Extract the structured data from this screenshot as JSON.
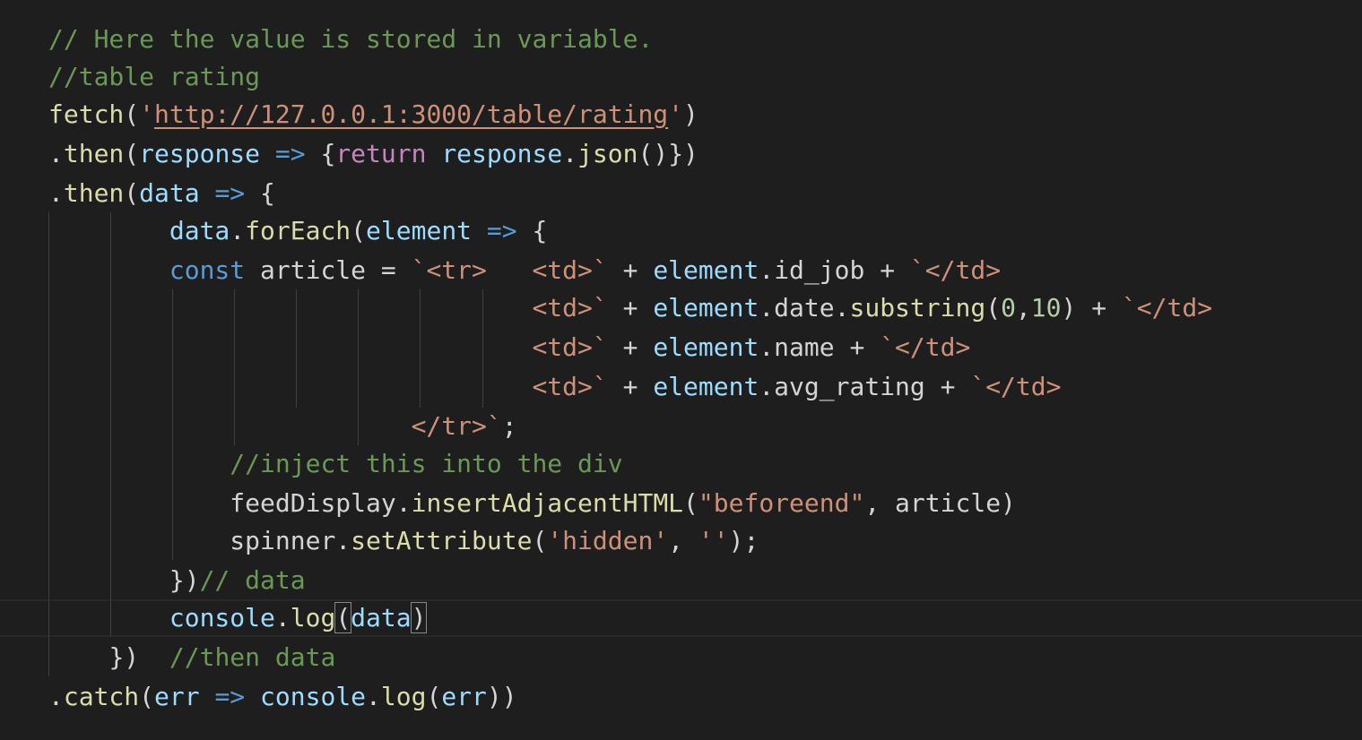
{
  "editor": {
    "theme_colors": {
      "background": "#1e1e1e",
      "comment": "#6a9955",
      "function": "#dcdcaa",
      "string": "#ce9178",
      "variable": "#9cdcfe",
      "keyword": "#569cd6",
      "control": "#c586c0",
      "number": "#b5cea8",
      "plain": "#d4d4d4"
    },
    "lines": [
      {
        "indent": 0,
        "tokens": [
          {
            "t": "com",
            "v": "// Here the value is stored in variable."
          }
        ]
      },
      {
        "indent": 0,
        "tokens": [
          {
            "t": "com",
            "v": "//table rating"
          }
        ]
      },
      {
        "indent": 0,
        "tokens": [
          {
            "t": "fn",
            "v": "fetch"
          },
          {
            "t": "pl",
            "v": "("
          },
          {
            "t": "str",
            "v": "'"
          },
          {
            "t": "url",
            "v": "http://127.0.0.1:3000/table/rating"
          },
          {
            "t": "str",
            "v": "'"
          },
          {
            "t": "pl",
            "v": ")"
          }
        ]
      },
      {
        "indent": 0,
        "tokens": [
          {
            "t": "pl",
            "v": "."
          },
          {
            "t": "fn",
            "v": "then"
          },
          {
            "t": "pl",
            "v": "("
          },
          {
            "t": "var",
            "v": "response"
          },
          {
            "t": "pl",
            "v": " "
          },
          {
            "t": "kw",
            "v": "=>"
          },
          {
            "t": "pl",
            "v": " {"
          },
          {
            "t": "ctl",
            "v": "return"
          },
          {
            "t": "pl",
            "v": " "
          },
          {
            "t": "var",
            "v": "response"
          },
          {
            "t": "pl",
            "v": "."
          },
          {
            "t": "fn",
            "v": "json"
          },
          {
            "t": "pl",
            "v": "()})"
          }
        ]
      },
      {
        "indent": 0,
        "tokens": [
          {
            "t": "pl",
            "v": "."
          },
          {
            "t": "fn",
            "v": "then"
          },
          {
            "t": "pl",
            "v": "("
          },
          {
            "t": "var",
            "v": "data"
          },
          {
            "t": "pl",
            "v": " "
          },
          {
            "t": "kw",
            "v": "=>"
          },
          {
            "t": "pl",
            "v": " {"
          }
        ]
      },
      {
        "indent": 8,
        "tokens": [
          {
            "t": "var",
            "v": "data"
          },
          {
            "t": "pl",
            "v": "."
          },
          {
            "t": "fn",
            "v": "forEach"
          },
          {
            "t": "pl",
            "v": "("
          },
          {
            "t": "var",
            "v": "element"
          },
          {
            "t": "pl",
            "v": " "
          },
          {
            "t": "kw",
            "v": "=>"
          },
          {
            "t": "pl",
            "v": " {"
          }
        ]
      },
      {
        "indent": 8,
        "tokens": [
          {
            "t": "kw",
            "v": "const"
          },
          {
            "t": "pl",
            "v": " article = "
          },
          {
            "t": "str",
            "v": "`<tr>   <td>`"
          },
          {
            "t": "pl",
            "v": " + "
          },
          {
            "t": "var",
            "v": "element"
          },
          {
            "t": "pl",
            "v": ".id_job + "
          },
          {
            "t": "str",
            "v": "`</td>"
          }
        ]
      },
      {
        "indent": 32,
        "tokens": [
          {
            "t": "str",
            "v": "<td>`"
          },
          {
            "t": "pl",
            "v": " + "
          },
          {
            "t": "var",
            "v": "element"
          },
          {
            "t": "pl",
            "v": ".date."
          },
          {
            "t": "fn",
            "v": "substring"
          },
          {
            "t": "pl",
            "v": "("
          },
          {
            "t": "num",
            "v": "0"
          },
          {
            "t": "pl",
            "v": ","
          },
          {
            "t": "num",
            "v": "10"
          },
          {
            "t": "pl",
            "v": ") + "
          },
          {
            "t": "str",
            "v": "`</td>"
          }
        ]
      },
      {
        "indent": 32,
        "tokens": [
          {
            "t": "str",
            "v": "<td>`"
          },
          {
            "t": "pl",
            "v": " + "
          },
          {
            "t": "var",
            "v": "element"
          },
          {
            "t": "pl",
            "v": ".name + "
          },
          {
            "t": "str",
            "v": "`</td>"
          }
        ]
      },
      {
        "indent": 32,
        "tokens": [
          {
            "t": "str",
            "v": "<td>`"
          },
          {
            "t": "pl",
            "v": " + "
          },
          {
            "t": "var",
            "v": "element"
          },
          {
            "t": "pl",
            "v": ".avg_rating + "
          },
          {
            "t": "str",
            "v": "`</td>"
          }
        ]
      },
      {
        "indent": 24,
        "tokens": [
          {
            "t": "str",
            "v": "</tr>`"
          },
          {
            "t": "pl",
            "v": ";"
          }
        ]
      },
      {
        "indent": 12,
        "tokens": [
          {
            "t": "com",
            "v": "//inject this into the div"
          }
        ]
      },
      {
        "indent": 12,
        "tokens": [
          {
            "t": "pl",
            "v": "feedDisplay."
          },
          {
            "t": "fn",
            "v": "insertAdjacentHTML"
          },
          {
            "t": "pl",
            "v": "("
          },
          {
            "t": "str",
            "v": "\"beforeend\""
          },
          {
            "t": "pl",
            "v": ", article)"
          }
        ]
      },
      {
        "indent": 12,
        "tokens": [
          {
            "t": "pl",
            "v": "spinner."
          },
          {
            "t": "fn",
            "v": "setAttribute"
          },
          {
            "t": "pl",
            "v": "("
          },
          {
            "t": "str",
            "v": "'hidden'"
          },
          {
            "t": "pl",
            "v": ", "
          },
          {
            "t": "str",
            "v": "''"
          },
          {
            "t": "pl",
            "v": ");"
          }
        ]
      },
      {
        "indent": 8,
        "tokens": [
          {
            "t": "pl",
            "v": "})"
          },
          {
            "t": "com",
            "v": "// data"
          }
        ]
      },
      {
        "indent": 8,
        "tokens": [
          {
            "t": "var",
            "v": "console"
          },
          {
            "t": "pl",
            "v": "."
          },
          {
            "t": "fn",
            "v": "log"
          },
          {
            "t": "pl",
            "v": "(",
            "hl": true
          },
          {
            "t": "var",
            "v": "data"
          },
          {
            "t": "pl",
            "v": ")",
            "hl": true
          }
        ]
      },
      {
        "indent": 4,
        "tokens": [
          {
            "t": "pl",
            "v": "})  "
          },
          {
            "t": "com",
            "v": "//then data"
          }
        ]
      },
      {
        "indent": 0,
        "tokens": [
          {
            "t": "pl",
            "v": "."
          },
          {
            "t": "fn",
            "v": "catch"
          },
          {
            "t": "pl",
            "v": "("
          },
          {
            "t": "var",
            "v": "err"
          },
          {
            "t": "pl",
            "v": " "
          },
          {
            "t": "kw",
            "v": "=>"
          },
          {
            "t": "pl",
            "v": " "
          },
          {
            "t": "var",
            "v": "console"
          },
          {
            "t": "pl",
            "v": "."
          },
          {
            "t": "fn",
            "v": "log"
          },
          {
            "t": "pl",
            "v": "("
          },
          {
            "t": "var",
            "v": "err"
          },
          {
            "t": "pl",
            "v": "))"
          }
        ]
      }
    ]
  }
}
